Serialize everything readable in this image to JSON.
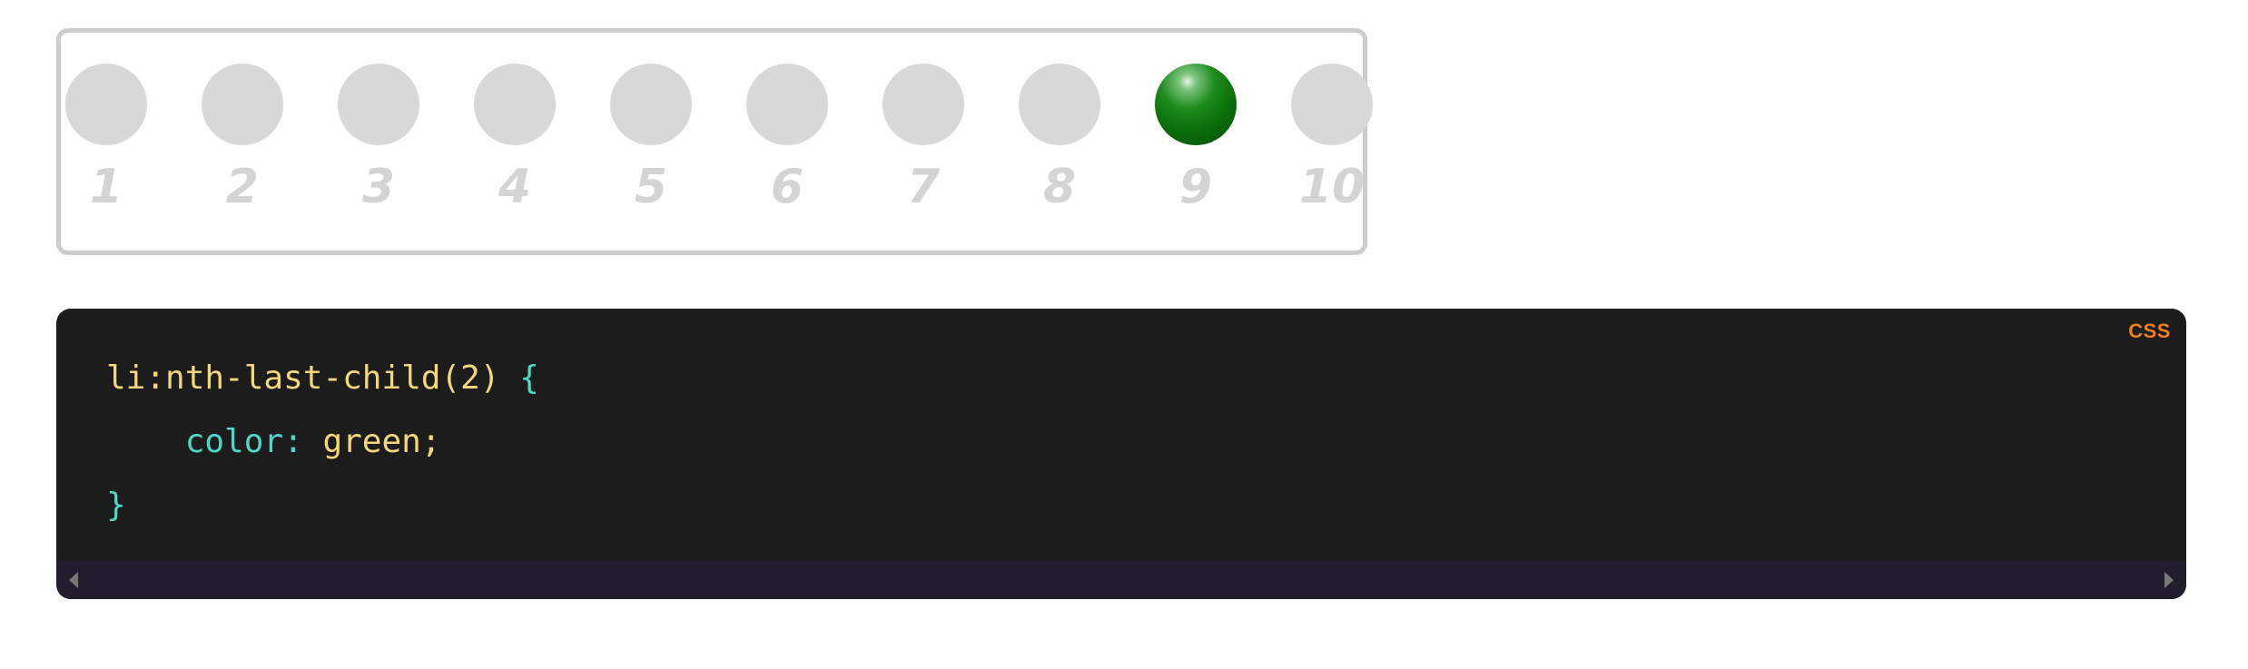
{
  "demo": {
    "items": [
      {
        "number": "1",
        "highlighted": false
      },
      {
        "number": "2",
        "highlighted": false
      },
      {
        "number": "3",
        "highlighted": false
      },
      {
        "number": "4",
        "highlighted": false
      },
      {
        "number": "5",
        "highlighted": false
      },
      {
        "number": "6",
        "highlighted": false
      },
      {
        "number": "7",
        "highlighted": false
      },
      {
        "number": "8",
        "highlighted": false
      },
      {
        "number": "9",
        "highlighted": true
      },
      {
        "number": "10",
        "highlighted": false
      }
    ],
    "ball_color": "#d8d8d8",
    "highlight_color": "#0b6e0b"
  },
  "code_block": {
    "language": "CSS",
    "lines": {
      "selector": "li:nth-last-child(2)",
      "open_brace": "{",
      "property": "color",
      "colon": ":",
      "value": "green",
      "semicolon": ";",
      "close_brace": "}"
    },
    "colors": {
      "background": "#1c1c1c",
      "selector": "#f5d67b",
      "punctuation": "#4fd6c8",
      "badge": "#f0801a"
    }
  },
  "scrollbar": {
    "left_arrow_icon": "arrow-left-icon",
    "right_arrow_icon": "arrow-right-icon"
  }
}
